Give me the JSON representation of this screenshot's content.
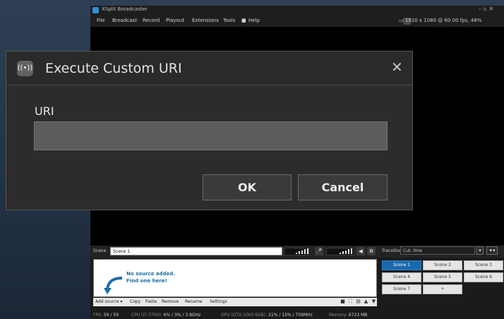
{
  "app": {
    "title": "XSplit Broadcaster",
    "window_controls": "–  ▫  ✕"
  },
  "menu": [
    "File",
    "Broadcast",
    "Record",
    "Playout",
    "Extensions",
    "Tools",
    "Help"
  ],
  "menu_help_icon": "film-icon",
  "resolution": "1920 x 1080 @ 60.00 fps, 48%",
  "scene_bar": {
    "label": "Scene",
    "name_value": "Scene 1"
  },
  "sources": {
    "empty_line1": "No source added.",
    "empty_line2": "Find one here!"
  },
  "source_actions": [
    "Add source ▾",
    "Copy",
    "Paste",
    "Remove",
    "Rename",
    "Settings"
  ],
  "transition": {
    "label": "Transition",
    "value": "Cut: 0ms"
  },
  "scenes": [
    "Scene 1",
    "Scene 2",
    "Scene 3",
    "Scene 4",
    "Scene 5",
    "Scene 6",
    "Scene 7",
    "+"
  ],
  "status": {
    "fps_label": "FPS:",
    "fps_value": "59 / 59",
    "cpu_label": "CPU (i7-7700):",
    "cpu_value": "6% / 3% / 3.8GHz",
    "gpu_label": "GPU (GTX 1060 6GB):",
    "gpu_value": "21% / 15% / 759MHz",
    "mem_label": "Memory:",
    "mem_value": "6723 MB"
  },
  "dialog": {
    "title": "Execute Custom URI",
    "field_label": "URI",
    "field_value": "",
    "field_placeholder": "",
    "ok_label": "OK",
    "cancel_label": "Cancel"
  },
  "colors": {
    "accent": "#1a69ad",
    "dialog_bg": "#2c2c2c",
    "desktop_bg": "#263548"
  }
}
